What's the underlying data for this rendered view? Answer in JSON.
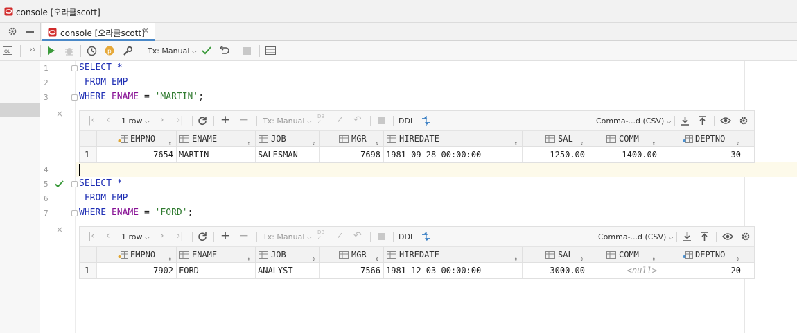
{
  "window": {
    "title": "console [오라클scott]"
  },
  "tab": {
    "label": "console [오라클scott]"
  },
  "toolbar": {
    "tx_mode": "Tx: Manual"
  },
  "editor": {
    "line_numbers": [
      "1",
      "2",
      "3",
      "4",
      "5",
      "6",
      "7"
    ],
    "query1": {
      "line1": "SELECT *",
      "line2": " FROM EMP",
      "where_kw": "WHERE",
      "where_col": "ENAME",
      "where_op": "=",
      "where_val": "'MARTIN'",
      "where_end": ";"
    },
    "query2": {
      "line1": "SELECT *",
      "line2": " FROM EMP",
      "where_kw": "WHERE",
      "where_col": "ENAME",
      "where_op": "=",
      "where_val": "'FORD'",
      "where_end": ";"
    }
  },
  "result_toolbar": {
    "rows_label": "1 row",
    "tx_mode": "Tx: Manual",
    "ddl_label": "DDL",
    "export_format": "Comma-...d (CSV)"
  },
  "columns": [
    "EMPNO",
    "ENAME",
    "JOB",
    "MGR",
    "HIREDATE",
    "SAL",
    "COMM",
    "DEPTNO"
  ],
  "result1": {
    "rows": [
      {
        "num": "1",
        "empno": "7654",
        "ename": "MARTIN",
        "job": "SALESMAN",
        "mgr": "7698",
        "hiredate": "1981-09-28 00:00:00",
        "sal": "1250.00",
        "comm": "1400.00",
        "deptno": "30"
      }
    ]
  },
  "result2": {
    "rows": [
      {
        "num": "1",
        "empno": "7902",
        "ename": "FORD",
        "job": "ANALYST",
        "mgr": "7566",
        "hiredate": "1981-12-03 00:00:00",
        "sal": "3000.00",
        "comm": "<null>",
        "deptno": "20"
      }
    ]
  },
  "colors": {
    "keyword": "#1f2fb4",
    "column": "#871094",
    "string": "#2f7a2f",
    "run": "#3a9a3a",
    "oracle_red": "#c22",
    "tab_accent": "#4a88c7"
  }
}
